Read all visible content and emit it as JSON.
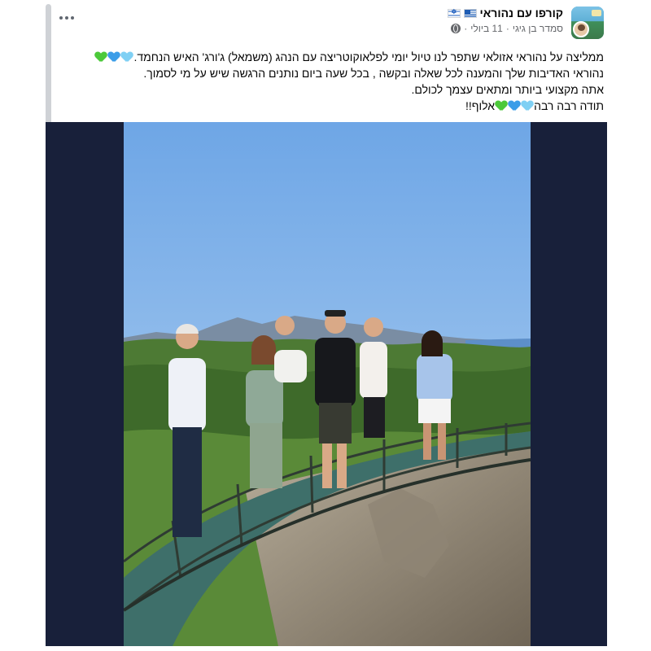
{
  "post": {
    "page_name": "קורפו עם נהוראי",
    "author": "סמדר בן גיגי",
    "date": "11 ביולי",
    "separator": "·",
    "more_label": "...",
    "lines": [
      "ממליצה על נהוראי אזולאי שתפר לנו טיול יומי לפלאוקוטריצה עם הנהג (משמאל) ג'ורג' האיש הנחמד.",
      "נהוראי האדיבות שלך והמענה לכל שאלה ובקשה , בכל שעה ביום נותנים הרגשה שיש על מי לסמוך.",
      "אתה מקצועי ביותר ומתאים עצמך לכולם.",
      "תודה רבה רבה"
    ],
    "last_line_tail": "אלוף!!"
  },
  "colors": {
    "photo_frame": "#18203a",
    "meta_text": "#65676b",
    "heart_green": "#4cc93a",
    "heart_blue": "#3b9de8",
    "heart_light_blue": "#7fd0f4"
  },
  "icons": {
    "globe": "globe-icon",
    "more": "more-options-icon",
    "flag_israel": "israel-flag-icon",
    "flag_greece": "greece-flag-icon"
  }
}
